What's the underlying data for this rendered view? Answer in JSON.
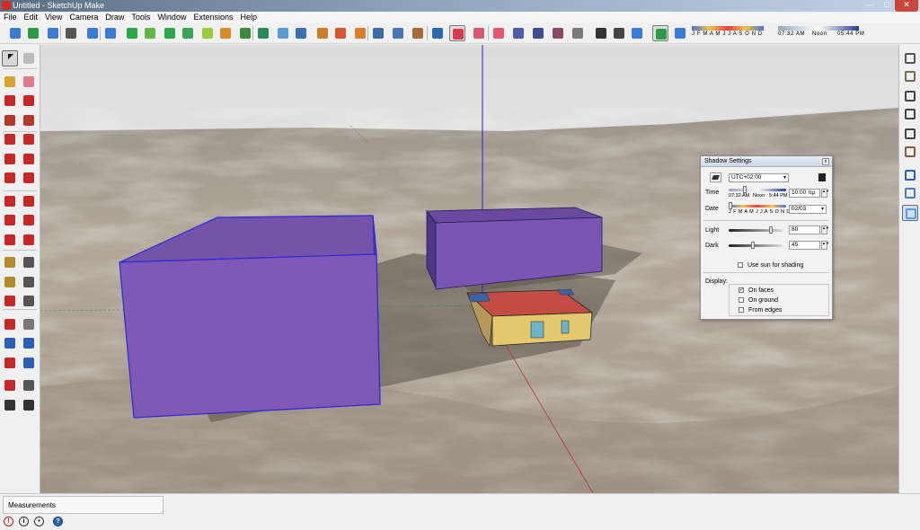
{
  "window": {
    "title": "Untitled - SketchUp Make",
    "controls": {
      "minimize": "—",
      "maximize": "□",
      "close": "✕"
    }
  },
  "menu": [
    "File",
    "Edit",
    "View",
    "Camera",
    "Draw",
    "Tools",
    "Window",
    "Extensions",
    "Help"
  ],
  "toolbar": {
    "months_label": "J F M A M J J A S O N D",
    "time_start": "07:32 AM",
    "time_mid": "Noon",
    "time_end": "05:44 PM"
  },
  "shadow_dialog": {
    "title": "Shadow Settings",
    "close": "x",
    "timezone": "UTC+02:00",
    "time_label": "Time",
    "time_start": "07:32 AM",
    "time_noon": "Noon",
    "time_end": "5:44 PM",
    "time_value": "10:00 πμ",
    "date_label": "Date",
    "date_months": "J F M A M J J A S O N D",
    "date_value": "02/03",
    "light_label": "Light",
    "light_value": "80",
    "dark_label": "Dark",
    "dark_value": "45",
    "use_sun_label": "Use sun for shading",
    "use_sun_checked": false,
    "display_label": "Display:",
    "display_options": [
      {
        "label": "On faces",
        "checked": true
      },
      {
        "label": "On ground",
        "checked": false
      },
      {
        "label": "From edges",
        "checked": false
      }
    ]
  },
  "status": {
    "measurements_label": "Measurements",
    "icons": [
      "warning-icon",
      "info-icon",
      "user-icon",
      "help-icon"
    ]
  },
  "icons": {
    "left_tools": [
      "select-icon",
      "make-component-icon",
      "paint-bucket-icon",
      "eraser-icon",
      "line-icon",
      "freehand-icon",
      "rectangle-icon",
      "rotated-rectangle-icon",
      "circle-icon",
      "polygon-icon",
      "arc-icon",
      "pie-icon",
      "two-point-arc-icon",
      "three-point-arc-icon",
      "move-icon",
      "push-pull-icon",
      "rotate-icon",
      "follow-me-icon",
      "scale-icon",
      "offset-icon",
      "tape-measure-icon",
      "dimension-icon",
      "protractor-icon",
      "text-icon",
      "axes-icon",
      "3d-text-icon",
      "orbit-icon",
      "pan-icon",
      "zoom-icon",
      "zoom-window-icon",
      "zoom-extents-icon",
      "previous-view-icon",
      "position-camera-icon",
      "look-around-icon",
      "walk-icon",
      "section-plane-icon"
    ],
    "right_views": [
      "iso-view-icon",
      "top-view-icon",
      "front-view-icon",
      "right-view-icon",
      "back-view-icon",
      "left-view-icon",
      "xray-icon",
      "back-edges-icon",
      "wireframe-icon"
    ]
  },
  "colors": {
    "box_face": "#7b55b4",
    "box_edge": "#2a2ad6",
    "house_wall": "#e4c96c",
    "house_roof": "#c34d44",
    "axis_blue": "#2424c8",
    "axis_red": "#c03030",
    "sky": "#e8e8e8"
  }
}
